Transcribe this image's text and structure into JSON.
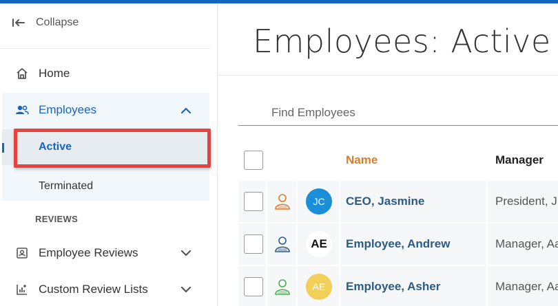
{
  "sidebar": {
    "collapse_label": "Collapse",
    "home_label": "Home",
    "employees_label": "Employees",
    "active_label": "Active",
    "terminated_label": "Terminated",
    "reviews_section": "REVIEWS",
    "employee_reviews_label": "Employee Reviews",
    "custom_review_lists_label": "Custom Review Lists"
  },
  "main": {
    "title": "Employees: Active",
    "search_placeholder": "Find Employees"
  },
  "table": {
    "columns": {
      "name": "Name",
      "manager": "Manager"
    },
    "rows": [
      {
        "initials": "JC",
        "avatar_color": "#1a8fd8",
        "person_icon_color": "#e07b27",
        "name": "CEO, Jasmine",
        "manager": "President, J"
      },
      {
        "initials": "AE",
        "avatar_color": "#ffffff",
        "person_icon_color": "#2b5b86",
        "name": "Employee, Andrew",
        "manager": "Manager, Aa"
      },
      {
        "initials": "AE",
        "avatar_color": "#f2cf59",
        "person_icon_color": "#4caf50",
        "name": "Employee, Asher",
        "manager": "Manager, Aa"
      }
    ]
  },
  "colors": {
    "accent": "#1565c0",
    "highlight": "#e8423f",
    "sort_column": "#e07b27"
  }
}
